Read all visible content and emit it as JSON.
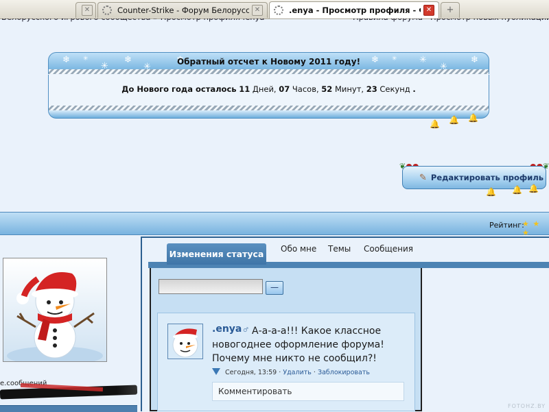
{
  "browser": {
    "tabs": [
      {
        "title": "",
        "active": false
      },
      {
        "title": "Counter-Strike - Форум Белорусского ...",
        "active": false
      },
      {
        "title": ".enya - Просмотр профиля - Фор...",
        "active": true
      }
    ],
    "new_tab_symbol": "+"
  },
  "breadcrumb": {
    "left": "Белорусского игрового сообщества » Просмотр профиля .enya",
    "right": "Правила форума · Просмотр новых публикаций"
  },
  "countdown": {
    "title": "Обратный отсчет к Новому 2011 году!",
    "prefix": "До Нового года осталось",
    "days": "11",
    "days_label": "Дней,",
    "hours": "07",
    "hours_label": "Часов,",
    "minutes": "52",
    "minutes_label": "Минут,",
    "seconds": "23",
    "seconds_label": "Секунд",
    "end": "."
  },
  "profile_actions": {
    "edit_label": "Редактировать профиль"
  },
  "rating": {
    "label": "Рейтинг:",
    "stars": "★ ★ ★",
    "value": 3
  },
  "user": {
    "nickname_partial": "е.сообщений"
  },
  "tabs": {
    "status": "Изменения статуса",
    "about": "Обо мне",
    "topics": "Темы",
    "messages": "Сообщения"
  },
  "status_form": {
    "input_value": "",
    "submit_label": "—"
  },
  "post": {
    "author": ".enya",
    "text": "А-а-а-а!!! Какое классное новогоднее оформление форума! Почему мне никто не сообщил?!",
    "time": "Сегодня, 13:59",
    "delete_label": "Удалить",
    "block_label": "Заблокировать",
    "separator": "·",
    "comment_placeholder": "Комментировать"
  },
  "watermark": "FOTOHZ.BY"
}
